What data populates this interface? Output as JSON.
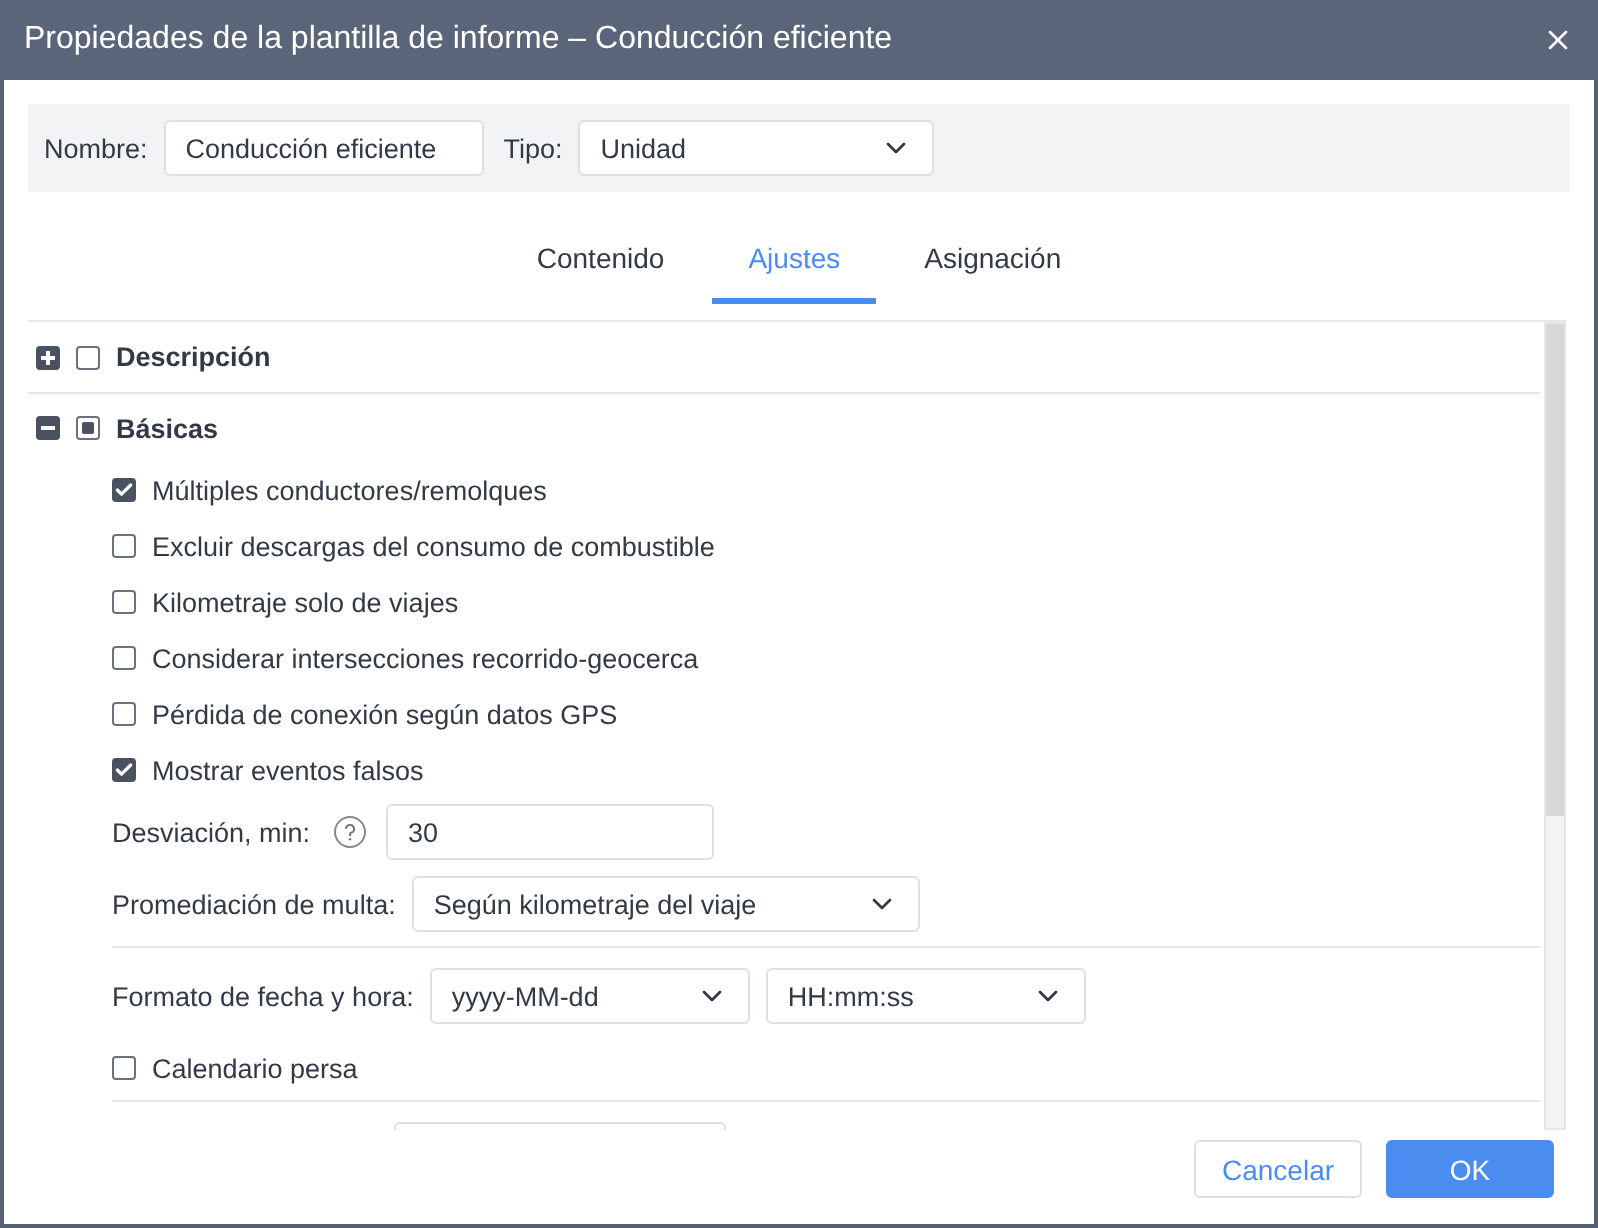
{
  "window": {
    "title": "Propiedades de la plantilla de informe – Conducción eficiente"
  },
  "header": {
    "name_label": "Nombre:",
    "name_value": "Conducción eficiente",
    "type_label": "Tipo:",
    "type_value": "Unidad"
  },
  "tabs": [
    {
      "label": "Contenido",
      "selected": false
    },
    {
      "label": "Ajustes",
      "selected": true
    },
    {
      "label": "Asignación",
      "selected": false
    }
  ],
  "sections": [
    {
      "title": "Descripción",
      "expanded": false,
      "checked": false,
      "indeterminate": false
    },
    {
      "title": "Básicas",
      "expanded": true,
      "checked": false,
      "indeterminate": true,
      "rows": [
        {
          "kind": "checkbox",
          "label": "Múltiples conductores/remolques",
          "checked": true
        },
        {
          "kind": "checkbox",
          "label": "Excluir descargas del consumo de combustible",
          "checked": false
        },
        {
          "kind": "checkbox",
          "label": "Kilometraje solo de viajes",
          "checked": false
        },
        {
          "kind": "checkbox",
          "label": "Considerar intersecciones recorrido-geocerca",
          "checked": false
        },
        {
          "kind": "checkbox",
          "label": "Pérdida de conexión según datos GPS",
          "checked": false
        },
        {
          "kind": "checkbox",
          "label": "Mostrar eventos falsos",
          "checked": true
        },
        {
          "kind": "number",
          "label": "Desviación, min:",
          "help": true,
          "value": "30"
        },
        {
          "kind": "select",
          "label": "Promediación de multa:",
          "value": "Según kilometraje del viaje"
        },
        {
          "kind": "divider"
        },
        {
          "kind": "datetime",
          "label": "Formato de fecha y hora:",
          "values": [
            "yyyy-MM-dd",
            "HH:mm:ss"
          ]
        },
        {
          "kind": "checkbox",
          "label": "Calendario persa",
          "checked": false
        },
        {
          "kind": "divider"
        },
        {
          "kind": "clipped"
        }
      ]
    }
  ],
  "buttons": [
    {
      "label": "Cancelar",
      "kind": "secondary"
    },
    {
      "label": "OK",
      "kind": "primary"
    }
  ]
}
